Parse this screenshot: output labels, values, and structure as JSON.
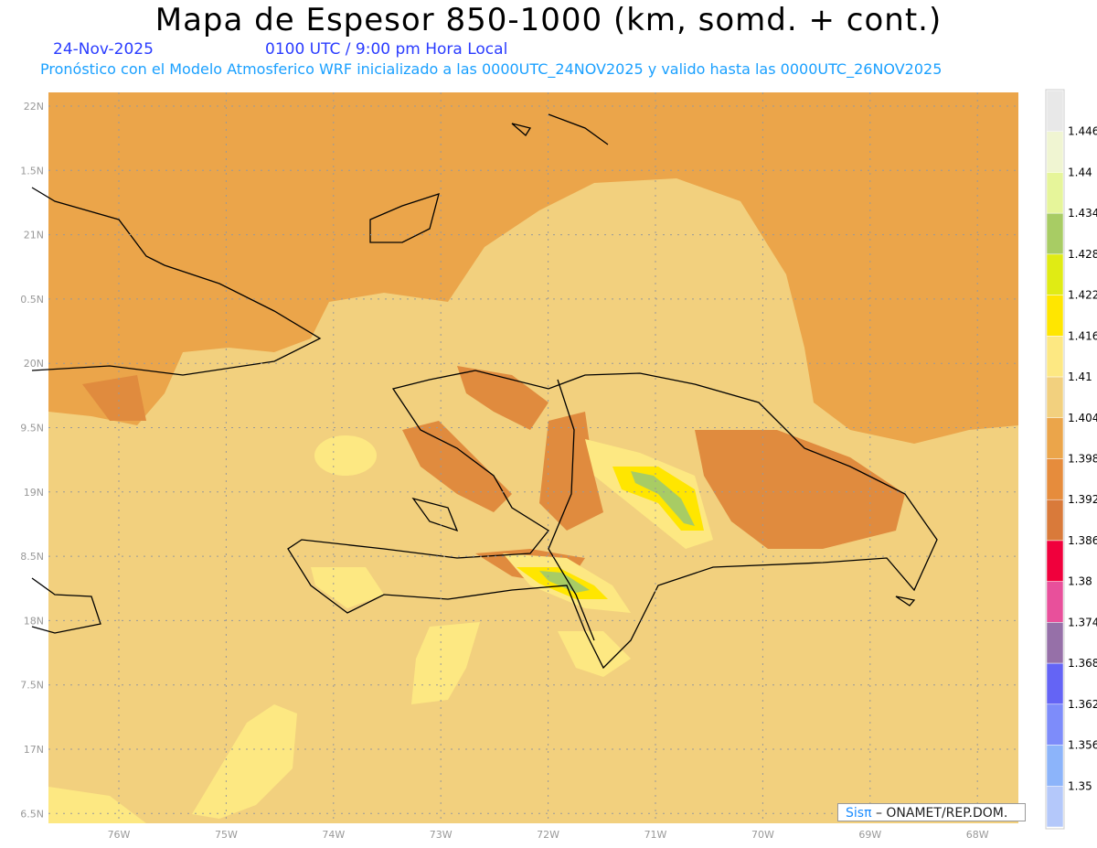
{
  "header": {
    "title": "Mapa de Espesor 850-1000 (km, somd. + cont.)",
    "date": "24-Nov-2025",
    "time": "0100 UTC / 9:00 pm Hora Local",
    "subtitle": "Pronóstico con el Modelo Atmosferico WRF inicializado a las 0000UTC_24NOV2025 y valido hasta las  0000UTC_26NOV2025"
  },
  "map": {
    "lon_labels": [
      "76W",
      "75W",
      "74W",
      "73W",
      "72W",
      "71W",
      "70W",
      "69W",
      "68W"
    ],
    "lat_labels": [
      "22N",
      "1.5N",
      "21N",
      "0.5N",
      "20N",
      "9.5N",
      "19N",
      "8.5N",
      "18N",
      "7.5N",
      "17N",
      "6.5N"
    ],
    "fill_colors": {
      "orange": "#eba54a",
      "tan": "#f2d07e",
      "yellow": "#fde882",
      "dark_orange": "#e08b3e",
      "bright_yellow": "#ffe600",
      "green": "#a8cc64",
      "lime": "#e0eb14"
    }
  },
  "colorbar": {
    "colors": [
      "#e8e8e8",
      "#f0f5d2",
      "#e6f59a",
      "#a8cc64",
      "#e0eb14",
      "#ffe600",
      "#fde882",
      "#f2d07e",
      "#eba54a",
      "#e68c3c",
      "#d97a3a",
      "#f0003c",
      "#e8509b",
      "#9670a8",
      "#6464f5",
      "#7d8cfa",
      "#8cb4fa",
      "#b4c8fa"
    ],
    "labels": [
      "1.446",
      "1.44",
      "1.434",
      "1.428",
      "1.422",
      "1.416",
      "1.41",
      "1.404",
      "1.398",
      "1.392",
      "1.386",
      "1.38",
      "1.374",
      "1.368",
      "1.362",
      "1.356",
      "1.35"
    ]
  },
  "credit": {
    "brand": "Sisπ",
    "text": " –  ONAMET/REP.DOM."
  }
}
